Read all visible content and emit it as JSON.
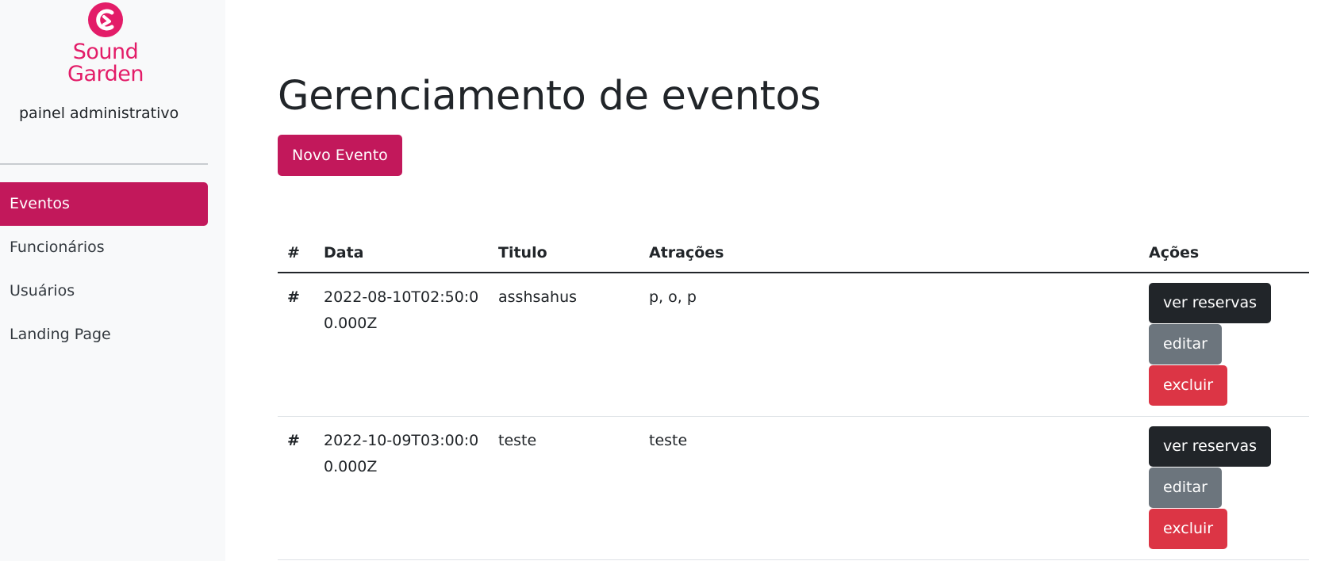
{
  "brand": {
    "line1": "Sound",
    "line2": "Garden",
    "subtitle": "painel administrativo",
    "color": "#e31c68"
  },
  "sidebar": {
    "items": [
      {
        "label": "Eventos",
        "active": true
      },
      {
        "label": "Funcionários",
        "active": false
      },
      {
        "label": "Usuários",
        "active": false
      },
      {
        "label": "Landing Page",
        "active": false
      }
    ]
  },
  "main": {
    "title": "Gerenciamento de eventos",
    "new_button": "Novo Evento",
    "table": {
      "headers": {
        "num": "#",
        "data": "Data",
        "titulo": "Titulo",
        "atracoes": "Atrações",
        "acoes": "Ações"
      },
      "rows": [
        {
          "num": "#",
          "data": "2022-08-10T02:50:00.000Z",
          "titulo": "asshsahus",
          "atracoes": "p, o, p"
        },
        {
          "num": "#",
          "data": "2022-10-09T03:00:00.000Z",
          "titulo": "teste",
          "atracoes": "teste"
        }
      ],
      "actions": {
        "reservas": "ver reservas",
        "editar": "editar",
        "excluir": "excluir"
      }
    }
  },
  "colors": {
    "primary": "#c2185b",
    "dark": "#212529",
    "gray": "#6c757d",
    "danger": "#dc3545"
  }
}
